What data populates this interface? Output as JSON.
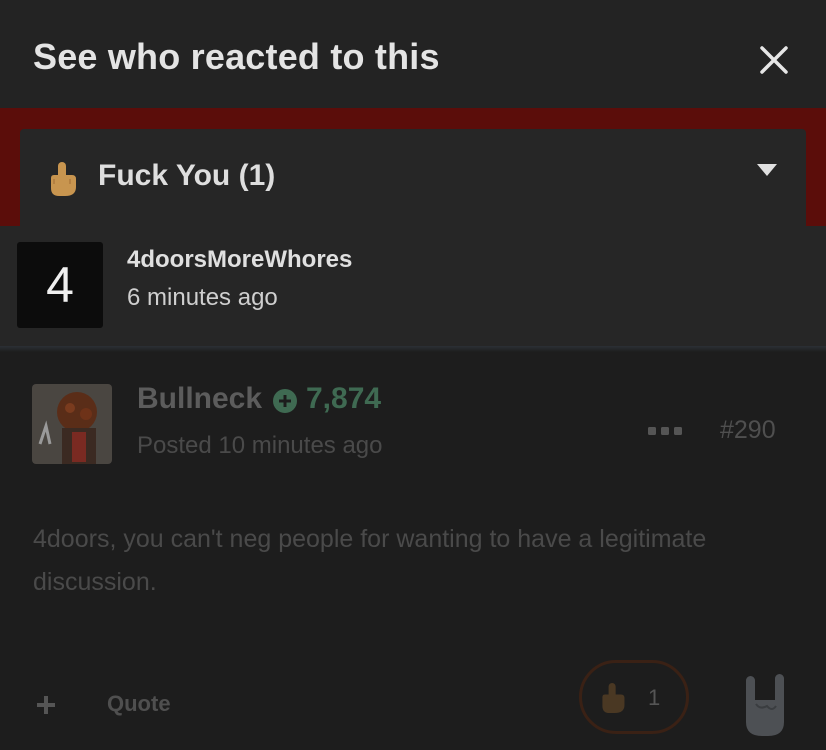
{
  "modal": {
    "title": "See who reacted to this",
    "group_label": "Fuck You (1)",
    "reactor": {
      "avatar_letter": "4",
      "name": "4doorsMoreWhores",
      "time": "6 minutes ago"
    }
  },
  "post": {
    "author": "Bullneck",
    "reputation": "7,874",
    "posted": "Posted 10 minutes ago",
    "number": "#290",
    "body": "4doors, you can't neg people for wanting to have a legitimate discussion.",
    "actions": {
      "quote": "Quote",
      "reaction_count": "1"
    }
  },
  "colors": {
    "accent_red": "#5b0d0a",
    "reputation_green": "#3f6a52",
    "emoji_skin": "#c8954f"
  }
}
